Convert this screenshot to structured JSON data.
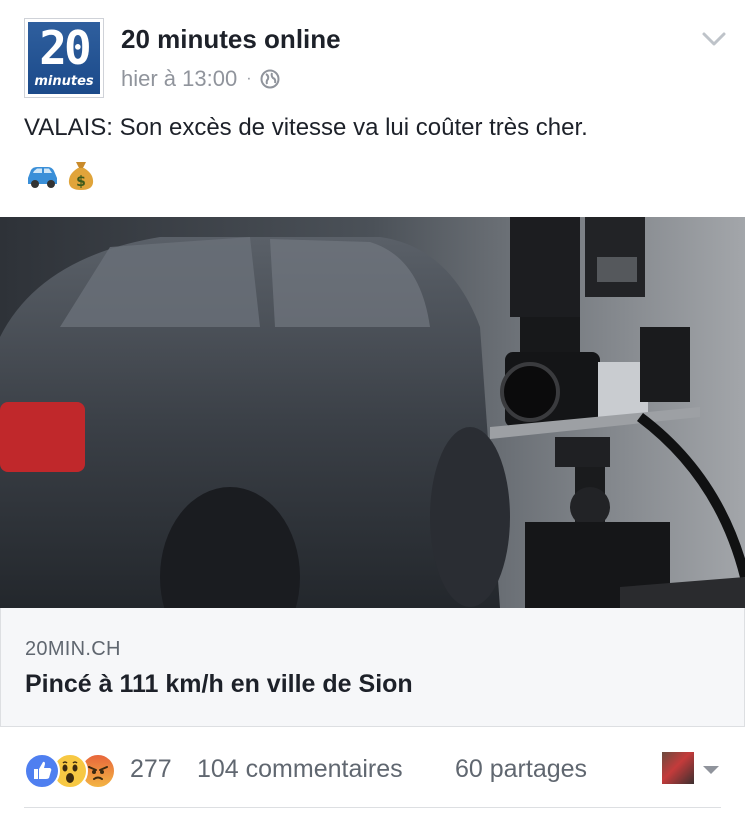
{
  "page": {
    "name": "20 minutes online",
    "logo_number": "20",
    "logo_word": "minutes",
    "timestamp": "hier à 13:00",
    "separator": "·",
    "privacy_icon": "globe-icon",
    "menu_icon": "chevron-down-icon"
  },
  "post": {
    "text": "VALAIS: Son excès de vitesse va lui coûter très cher.",
    "emojis": [
      "car-emoji",
      "money-bag-emoji"
    ]
  },
  "link": {
    "image_description_icon": "speed-camera-photo",
    "domain": "20MIN.CH",
    "title": "Pincé à 111 km/h en ville de Sion"
  },
  "reactions": {
    "types": [
      "like-icon",
      "wow-icon",
      "angry-icon"
    ],
    "count": "277",
    "comments": "104 commentaires",
    "shares": "60 partages"
  },
  "colors": {
    "brand_blue": "#1b4a8a",
    "like_blue": "#4f7ff0",
    "wow_yellow": "#f7c843",
    "angry_orange": "#e8663b",
    "meta_gray": "#90949c"
  }
}
